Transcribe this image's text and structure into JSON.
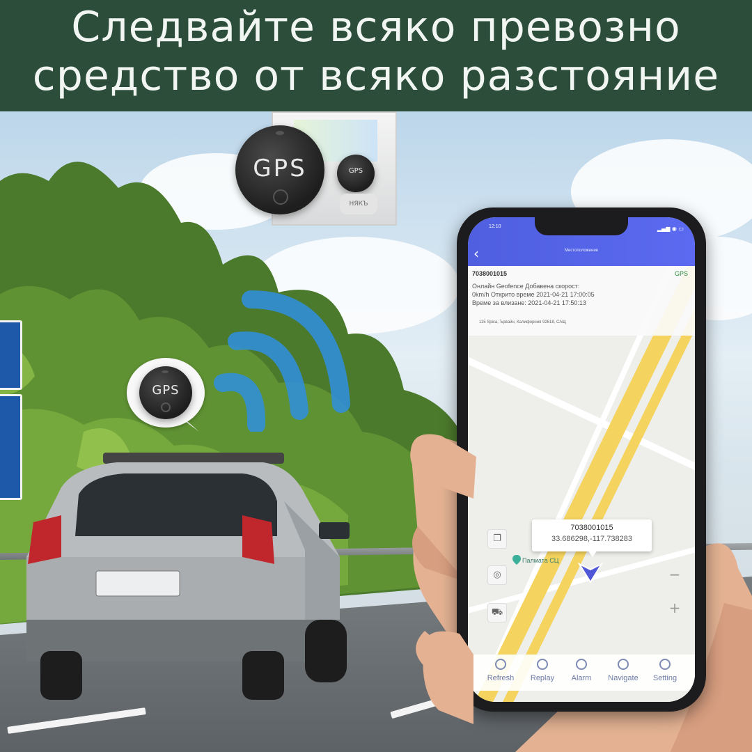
{
  "banner": {
    "line1": "Следвайте всяко превозно",
    "line2": "средство от всяко разстояние"
  },
  "devices": {
    "large_label": "GPS",
    "small_label": "GPS",
    "bubble_label": "GPS",
    "package_text": "НЯКЪ"
  },
  "phone": {
    "status_time": "12:10",
    "app_title": "Местоположение",
    "info": {
      "device_id": "7038001015",
      "gps_badge": "GPS",
      "line1": "Онлайн Geofence Добавена скорост:",
      "line2": "0km/h Открито време 2021-04-21 17:00:05",
      "line3": "Време за влизане: 2021-04-21 17:50:13",
      "address": "115 Spica, Ървайн, Калифорния 92618, САЩ"
    },
    "marker": {
      "device_id": "7038001015",
      "coordinates": "33.686298,-117.738283"
    },
    "poi_label": "Палмата СЦ",
    "tabs": [
      {
        "label": "Refresh",
        "icon": "refresh-icon"
      },
      {
        "label": "Replay",
        "icon": "replay-icon"
      },
      {
        "label": "Alarm",
        "icon": "alarm-icon"
      },
      {
        "label": "Navigate",
        "icon": "navigate-icon"
      },
      {
        "label": "Setting",
        "icon": "setting-icon"
      }
    ],
    "map_controls": {
      "zoom_in": "+",
      "zoom_out": "−"
    }
  },
  "colors": {
    "banner_bg": "#2c4d3a",
    "appbar": "#5563e6",
    "signal_waves": "#2f8fe0"
  }
}
